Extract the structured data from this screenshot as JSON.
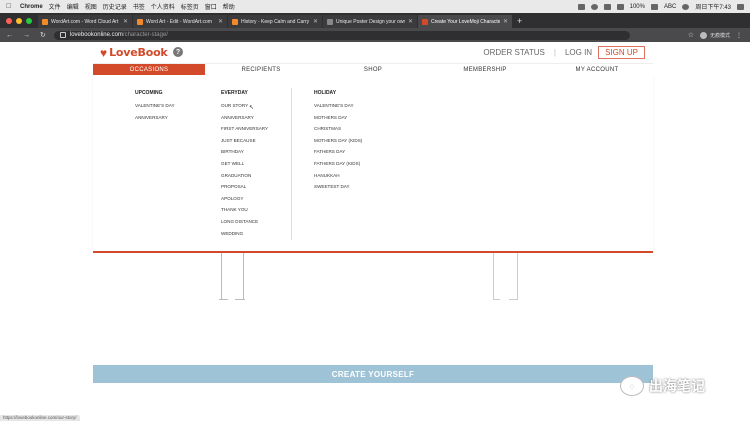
{
  "mac_menu": {
    "app": "Chrome",
    "items": [
      "文件",
      "编辑",
      "视图",
      "历史记录",
      "书签",
      "个人资料",
      "标签页",
      "窗口",
      "帮助"
    ],
    "battery": "100%",
    "input": "ABC",
    "clock": "周日下午7:43"
  },
  "tabs": [
    {
      "title": "WordArt.com - Word Cloud Art",
      "color": "#f08a2a",
      "active": false
    },
    {
      "title": "Word Art - Edit - WordArt.com",
      "color": "#f08a2a",
      "active": false
    },
    {
      "title": "History - Keep Calm and Carry",
      "color": "#f08a2a",
      "active": false
    },
    {
      "title": "Unique Poster Design your own",
      "color": "#888888",
      "active": false
    },
    {
      "title": "Create Your LoveMoji Character",
      "color": "#d24a2a",
      "active": true
    }
  ],
  "addressbar": {
    "domain": "lovebookonline.com",
    "path": "/character-stage/",
    "profile": "无痕模式"
  },
  "header": {
    "logo": "LoveBook",
    "help": "?",
    "order_status": "ORDER STATUS",
    "login": "LOG IN",
    "signup": "SIGN UP"
  },
  "nav": [
    "OCCASIONS",
    "RECIPIENTS",
    "SHOP",
    "MEMBERSHIP",
    "MY ACCOUNT"
  ],
  "mega": {
    "upcoming": {
      "title": "UPCOMING",
      "items": [
        "VALENTINE'S DAY",
        "ANNIVERSARY"
      ]
    },
    "everyday": {
      "title": "EVERYDAY",
      "items": [
        "OUR STORY",
        "ANNIVERSARY",
        "FIRST ANNIVERSARY",
        "JUST BECAUSE",
        "BIRTHDAY",
        "GET WELL",
        "GRADUATION",
        "PROPOSAL",
        "APOLOGY",
        "THANK YOU",
        "LONG DISTANCE",
        "WEDDING"
      ]
    },
    "holiday": {
      "title": "HOLIDAY",
      "items": [
        "VALENTINE'S DAY",
        "MOTHERS DAY",
        "CHRISTMAS",
        "MOTHERS DAY (KIDS)",
        "FATHERS DAY",
        "FATHERS DAY (KIDS)",
        "HANUKKAH",
        "SWEETEST DAY"
      ]
    }
  },
  "cta": "CREATE YOURSELF",
  "watermark": "出海笔记",
  "status_url": "https://lovebookonline.com/our-story/",
  "colors": {
    "brand": "#d24a2a",
    "cta": "#9ec3d6"
  }
}
